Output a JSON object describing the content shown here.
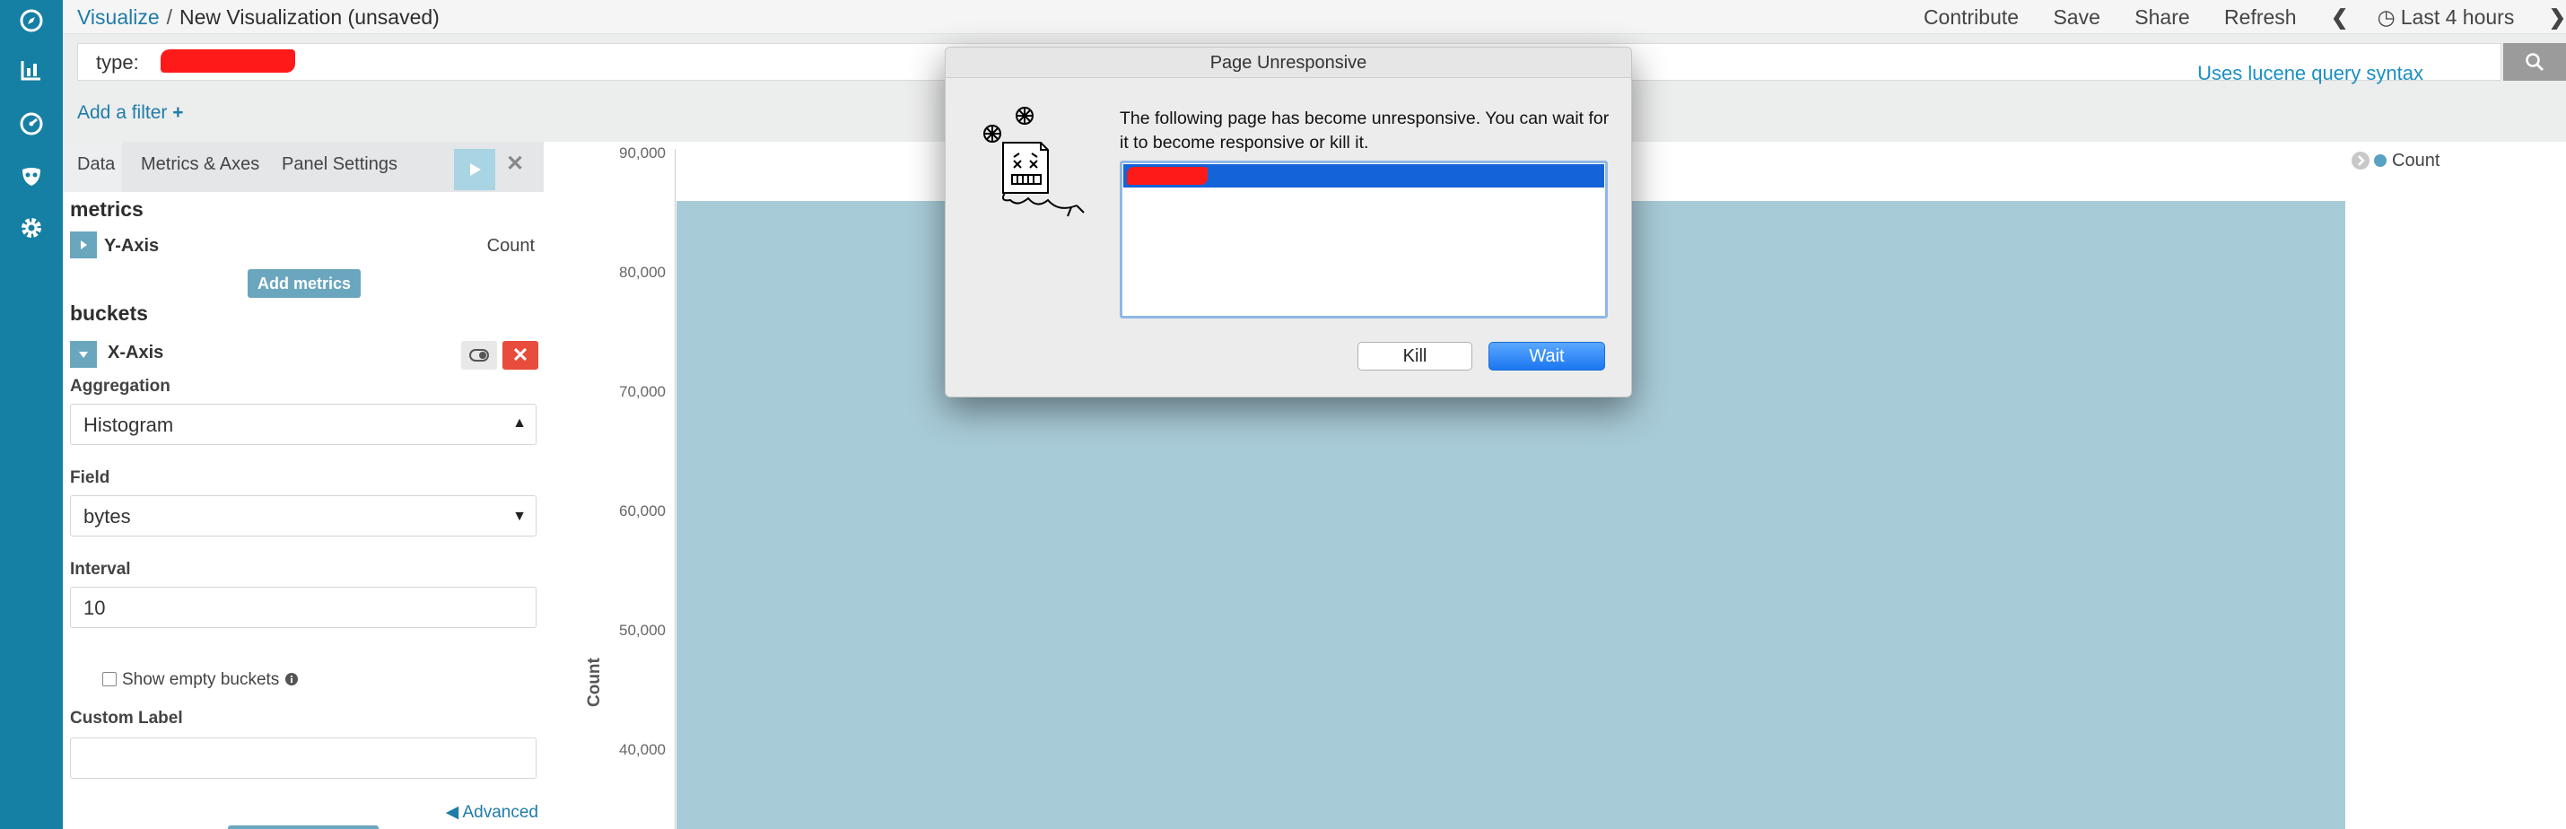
{
  "colors": {
    "nav_bg": "#167fa4",
    "accent": "#1f7ca8",
    "bar": "#a8cbd8",
    "danger": "#e74c3c",
    "wait_button": "#1b76f0"
  },
  "leftnav": {
    "icons": [
      "compass-icon",
      "visualize-chart-icon",
      "dashboard-gauge-icon",
      "timelion-mask-icon",
      "gear-icon"
    ]
  },
  "breadcrumb": {
    "root": "Visualize",
    "separator": "/",
    "current": "New Visualization (unsaved)"
  },
  "topnav": {
    "contribute": "Contribute",
    "save": "Save",
    "share": "Share",
    "refresh": "Refresh",
    "time_range": "Last 4 hours"
  },
  "query": {
    "prefix": "type:",
    "syntax_hint": "Uses lucene query syntax"
  },
  "filter": {
    "add_label": "Add a filter",
    "add_symbol": "+"
  },
  "sidebar": {
    "tabs": [
      "Data",
      "Metrics & Axes",
      "Panel Settings"
    ],
    "metrics": {
      "heading": "metrics",
      "y_axis_label": "Y-Axis",
      "y_axis_value": "Count",
      "add_button": "Add metrics"
    },
    "buckets": {
      "heading": "buckets",
      "x_axis_label": "X-Axis",
      "aggregation_label": "Aggregation",
      "aggregation_value": "Histogram",
      "field_label": "Field",
      "field_value": "bytes",
      "interval_label": "Interval",
      "interval_value": "10",
      "show_empty_label": "Show empty buckets",
      "custom_label_label": "Custom Label",
      "custom_label_value": "",
      "advanced_label": "Advanced"
    }
  },
  "chart_data": {
    "type": "bar",
    "ylabel": "Count",
    "yticks": [
      "90,000",
      "80,000",
      "70,000",
      "60,000",
      "50,000",
      "40,000"
    ],
    "ylim": [
      40000,
      90000
    ],
    "legend": [
      {
        "name": "Count",
        "color": "#57a1c4"
      }
    ],
    "legend_position": "top-right",
    "values": [
      86000
    ]
  },
  "dialog": {
    "title": "Page Unresponsive",
    "message": "The following page has become unresponsive. You can wait for it to become responsive or kill it.",
    "kill_label": "Kill",
    "wait_label": "Wait"
  }
}
